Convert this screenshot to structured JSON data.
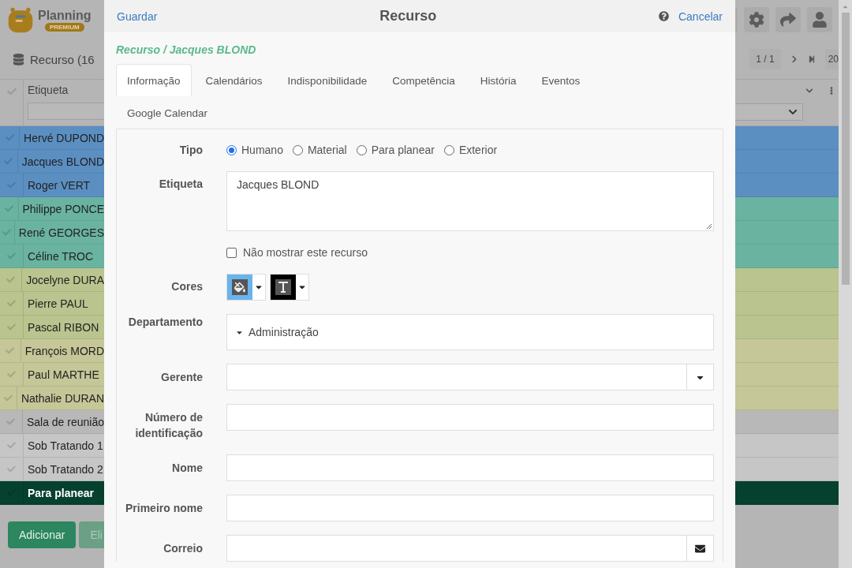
{
  "app": {
    "logo": {
      "name": "Planning",
      "badge": "PREMIUM"
    },
    "title": "Recurso (16",
    "pagination": {
      "page": "1 / 1",
      "page_size": "20"
    },
    "table": {
      "column": "Etiqueta",
      "rows": [
        {
          "label": "Hervé DUPOND",
          "color": "#5b8fc2"
        },
        {
          "label": "Jacques BLOND",
          "color": "#5b8fc2"
        },
        {
          "label": "Roger VERT",
          "color": "#5b8fc2"
        },
        {
          "label": "Philippe PONCE",
          "color": "#6ab3a1"
        },
        {
          "label": "René GEORGES",
          "color": "#6ab3a1"
        },
        {
          "label": "Céline TROC",
          "color": "#6ab3a1"
        },
        {
          "label": "Jocelyne DURA",
          "color": "#b9c48e"
        },
        {
          "label": "Pierre PAUL",
          "color": "#b9c48e"
        },
        {
          "label": "Pascal RIBON",
          "color": "#b9c48e"
        },
        {
          "label": "François MORD",
          "color": "#c5c798"
        },
        {
          "label": "Paul MARTHE",
          "color": "#c5c798"
        },
        {
          "label": "Nathalie DURAN",
          "color": "#c5c798"
        },
        {
          "label": "Sala de reunião",
          "color": "#b8b8b8"
        },
        {
          "label": "Sob Tratando 1",
          "color": "#c6c6c6"
        },
        {
          "label": "Sob Tratando 2",
          "color": "#c6c6c6"
        },
        {
          "label": "Para planear",
          "color": "#06402f"
        }
      ]
    },
    "buttons": [
      {
        "label": "Adicionar",
        "disabled": false
      },
      {
        "label": "Eli",
        "disabled": true
      }
    ]
  },
  "dialog": {
    "title": "Recurso",
    "save": "Guardar",
    "cancel": "Cancelar",
    "breadcrumb": "Recurso / Jacques BLOND",
    "tabs": [
      {
        "label": "Informação",
        "selected": true
      },
      {
        "label": "Calendários",
        "selected": false
      },
      {
        "label": "Indisponibilidade",
        "selected": false
      },
      {
        "label": "Competência",
        "selected": false
      },
      {
        "label": "História",
        "selected": false
      },
      {
        "label": "Eventos",
        "selected": false
      },
      {
        "label": "Google Calendar",
        "selected": false
      }
    ],
    "fields": [
      {
        "kind": "radio",
        "label": "Tipo",
        "options": [
          {
            "label": "Humano",
            "selected": true
          },
          {
            "label": "Material",
            "selected": false
          },
          {
            "label": "Para planear",
            "selected": false
          },
          {
            "label": "Exterior",
            "selected": false
          }
        ]
      },
      {
        "kind": "textarea",
        "label": "Etiqueta",
        "value": "Jacques BLOND"
      },
      {
        "kind": "checkbox",
        "text": "Não mostrar este recurso",
        "checked": false
      },
      {
        "kind": "colors",
        "label": "Cores",
        "swatches": [
          {
            "kind": "fill",
            "color": "#6ab4ec"
          },
          {
            "kind": "text",
            "color": "#000000"
          }
        ]
      },
      {
        "kind": "tree",
        "label": "Departamento",
        "value": "Administração"
      },
      {
        "kind": "select",
        "label": "Gerente"
      },
      {
        "kind": "text",
        "label": "Número de identificação"
      },
      {
        "kind": "text",
        "label": "Nome"
      },
      {
        "kind": "text",
        "label": "Primeiro nome"
      },
      {
        "kind": "email",
        "label": "Correio"
      }
    ]
  }
}
